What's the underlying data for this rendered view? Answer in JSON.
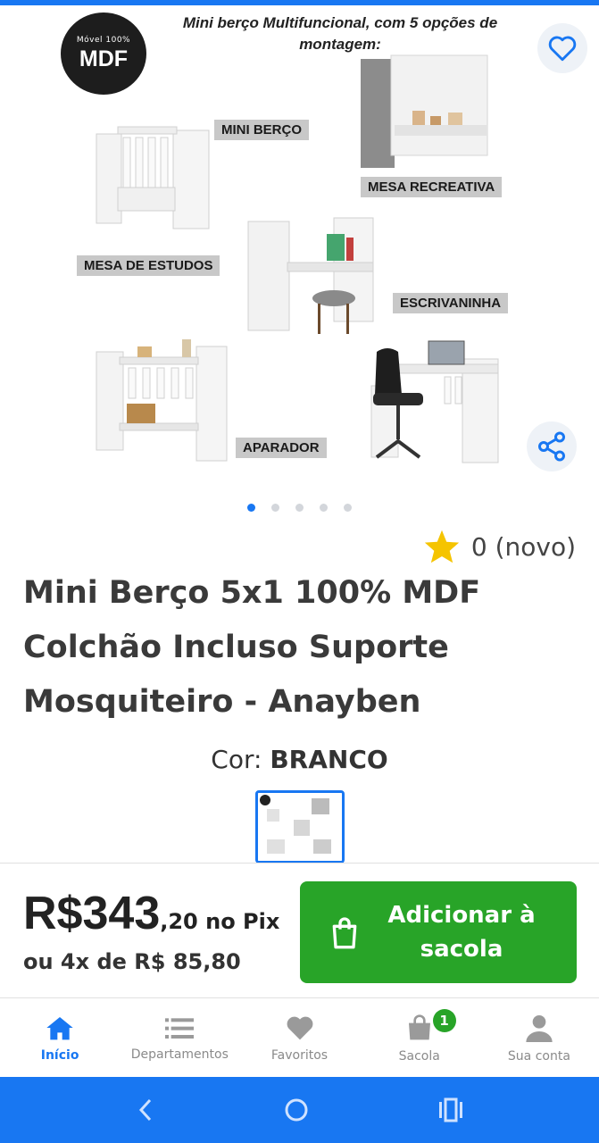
{
  "product_image": {
    "badge_small": "Móvel 100%",
    "badge_big": "MDF",
    "headline": "Mini berço Multifuncional, com 5 opções de montagem:",
    "labels": {
      "mini_berco": "MINI BERÇO",
      "mesa_recreativa": "MESA RECREATIVA",
      "mesa_estudos": "MESA DE ESTUDOS",
      "escrivaninha": "ESCRIVANINHA",
      "aparador": "APARADOR"
    },
    "carousel": {
      "count": 5,
      "active_index": 0
    }
  },
  "rating": {
    "stars_icon": "star-icon",
    "text": "0 (novo)"
  },
  "product": {
    "title": "Mini Berço 5x1 100% MDF Colchão Incluso Suporte Mosquiteiro - Anayben",
    "color_label": "Cor:",
    "color_value": "BRANCO"
  },
  "price": {
    "main": "R$343",
    "cents_suffix": ",20 no Pix",
    "installments": "ou 4x de R$ 85,80"
  },
  "add_button": {
    "label": "Adicionar à sacola"
  },
  "bottom_nav": [
    {
      "label": "Início",
      "icon": "home-icon",
      "active": true
    },
    {
      "label": "Departamentos",
      "icon": "list-icon",
      "active": false
    },
    {
      "label": "Favoritos",
      "icon": "heart-icon",
      "active": false
    },
    {
      "label": "Sacola",
      "icon": "bag-icon",
      "active": false,
      "badge": "1"
    },
    {
      "label": "Sua conta",
      "icon": "user-icon",
      "active": false
    }
  ],
  "colors": {
    "accent": "#1877f2",
    "buy_green": "#28a428"
  }
}
